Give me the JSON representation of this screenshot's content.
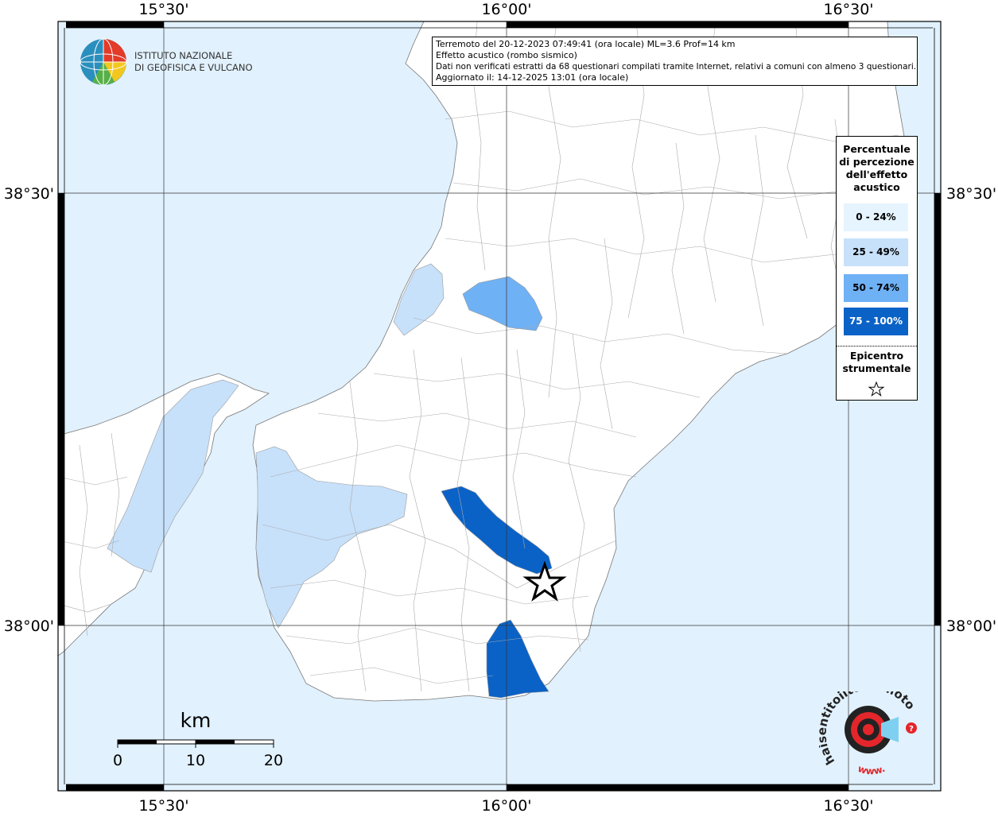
{
  "map": {
    "lon_labels": [
      "15°30'",
      "16°00'",
      "16°30'"
    ],
    "lat_labels": [
      "38°30'",
      "38°00'"
    ],
    "scalebar": {
      "unit": "km",
      "ticks": [
        "0",
        "10",
        "20"
      ]
    }
  },
  "info_box": {
    "line1": "Terremoto del 20-12-2023 07:49:41 (ora locale) ML=3.6 Prof=14 km",
    "line2": "Effetto acustico (rombo sismico)",
    "line3": "Dati non verificati estratti da 68 questionari compilati tramite Internet, relativi a comuni con almeno 3 questionari.",
    "line4": "Aggiornato il: 14-12-2025 13:01 (ora locale)"
  },
  "legend": {
    "title_lines": [
      "Percentuale",
      "di percezione",
      "dell'effetto",
      "acustico"
    ],
    "classes": [
      {
        "label": "0 - 24%",
        "color": "#e6f4ff",
        "text_color": "#000000"
      },
      {
        "label": "25 - 49%",
        "color": "#c7e1fb",
        "text_color": "#000000"
      },
      {
        "label": "50 - 74%",
        "color": "#6fb1f5",
        "text_color": "#000000"
      },
      {
        "label": "75 - 100%",
        "color": "#0a62c7",
        "text_color": "#ffffff"
      }
    ],
    "epicenter_lines": [
      "Epicentro",
      "strumentale"
    ]
  },
  "logos": {
    "ingv_line1": "ISTITUTO NAZIONALE",
    "ingv_line2": "DI GEOFISICA E VULCANOLOGIA",
    "hsit_text": "haisentitoilterremoto.it",
    "hsit_www": "www."
  },
  "colors": {
    "sea": "#e1f1fd",
    "land": "#ffffff",
    "border": "#999999",
    "frame": "#000000"
  }
}
